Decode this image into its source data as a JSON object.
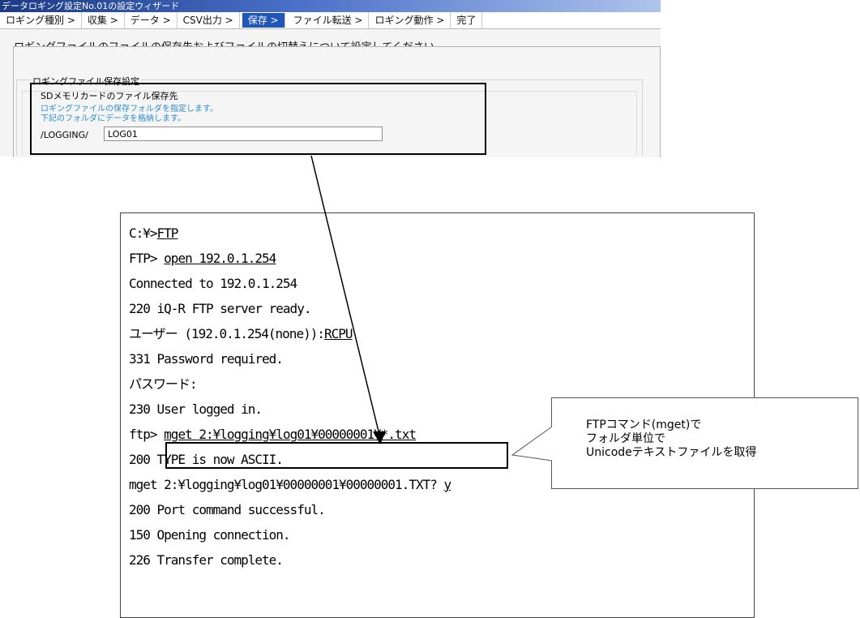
{
  "wizard": {
    "title": "データロギング設定No.01の設定ウィザード",
    "tabs": [
      {
        "label": "ロギング種別 >",
        "active": false
      },
      {
        "label": "収集 >",
        "active": false
      },
      {
        "label": "データ >",
        "active": false
      },
      {
        "label": "CSV出力 >",
        "active": false
      },
      {
        "label": "保存 >",
        "active": true
      },
      {
        "label": "ファイル転送 >",
        "active": false
      },
      {
        "label": "ロギング動作 >",
        "active": false
      },
      {
        "label": "完了",
        "active": false
      }
    ],
    "instruction": "ロギングファイルのファイルの保存先およびファイルの切替えについて設定してください。",
    "group_label": "ロギングファイル保存設定",
    "sd_group_label": "SDメモリカードのファイル保存先",
    "hint_line1": "ロギングファイルの保存フォルダを指定します。",
    "hint_line2": "下記のフォルダにデータを格納します。",
    "path_prefix": "/LOGGING/",
    "folder_value": "LOG01"
  },
  "terminal": {
    "lines": [
      {
        "prefix": "C:¥>",
        "cmd": "FTP",
        "suffix": ""
      },
      {
        "prefix": "FTP> ",
        "cmd": "open 192.0.1.254",
        "suffix": ""
      },
      {
        "prefix": "Connected to 192.0.1.254",
        "cmd": "",
        "suffix": ""
      },
      {
        "prefix": "220 iQ-R FTP server ready.",
        "cmd": "",
        "suffix": ""
      },
      {
        "prefix": "ユーザー (192.0.1.254(none)):",
        "cmd": "RCPU",
        "suffix": ""
      },
      {
        "prefix": "331 Password required.",
        "cmd": "",
        "suffix": ""
      },
      {
        "prefix": "パスワード:",
        "cmd": "",
        "suffix": ""
      },
      {
        "prefix": "230 User logged in.",
        "cmd": "",
        "suffix": ""
      },
      {
        "prefix": "ftp> ",
        "cmd": "mget 2:¥logging¥log01¥00000001¥*.txt",
        "suffix": ""
      },
      {
        "prefix": "200 TYPE is now ASCII.",
        "cmd": "",
        "suffix": ""
      },
      {
        "prefix": "mget 2:¥logging¥log01¥00000001¥00000001.TXT? ",
        "cmd": "y",
        "suffix": ""
      },
      {
        "prefix": "200 Port command successful.",
        "cmd": "",
        "suffix": ""
      },
      {
        "prefix": "150 Opening connection.",
        "cmd": "",
        "suffix": ""
      },
      {
        "prefix": "226 Transfer complete.",
        "cmd": "",
        "suffix": ""
      }
    ]
  },
  "callout": {
    "line1": "FTPコマンド(mget)で",
    "line2": "フォルダ単位で",
    "line3": "Unicodeテキストファイルを取得"
  }
}
